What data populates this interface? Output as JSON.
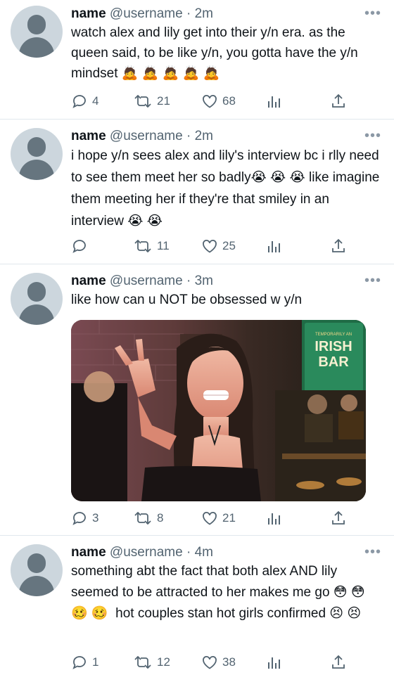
{
  "tweets": [
    {
      "name": "name",
      "handle": "@username",
      "time": "· 2m",
      "text": "watch alex and lily get into their y/n era. as the queen said, to be like y/n, you gotta have the y/n mindset 🙇 🙇 🙇 🙇 🙇",
      "reply_count": "4",
      "retweet_count": "21",
      "like_count": "68"
    },
    {
      "name": "name",
      "handle": "@username",
      "time": "· 2m",
      "text": "i hope y/n sees alex and lily's interview bc i rlly need to see them meet her so badly😭 😭 😭 like imagine them meeting her if they're that smiley in an interview 😭 😭",
      "reply_count": "",
      "retweet_count": "11",
      "like_count": "25"
    },
    {
      "name": "name",
      "handle": "@username",
      "time": "· 3m",
      "text": "like how can u NOT be obsessed w y/n",
      "reply_count": "3",
      "retweet_count": "8",
      "like_count": "21",
      "photo_sign_text": [
        "TEMPORARILY AN",
        "IRISH",
        "BAR"
      ]
    },
    {
      "name": "name",
      "handle": "@username",
      "time": "· 4m",
      "text": "something abt the fact that both alex AND lily seemed to be attracted to her makes me go 😳 😳 🥴 🥴  hot couples stan hot girls confirmed 😣 😣",
      "reply_count": "1",
      "retweet_count": "12",
      "like_count": "38"
    }
  ],
  "icons": {
    "reply": "reply-icon",
    "retweet": "retweet-icon",
    "like": "heart-icon",
    "analytics": "analytics-icon",
    "share": "share-icon",
    "more": "more-icon"
  },
  "colors": {
    "icon_gray": "#536471",
    "avatar_bg": "#ccd6dd",
    "avatar_fg": "#66757f",
    "divider": "#e1e8ed"
  }
}
